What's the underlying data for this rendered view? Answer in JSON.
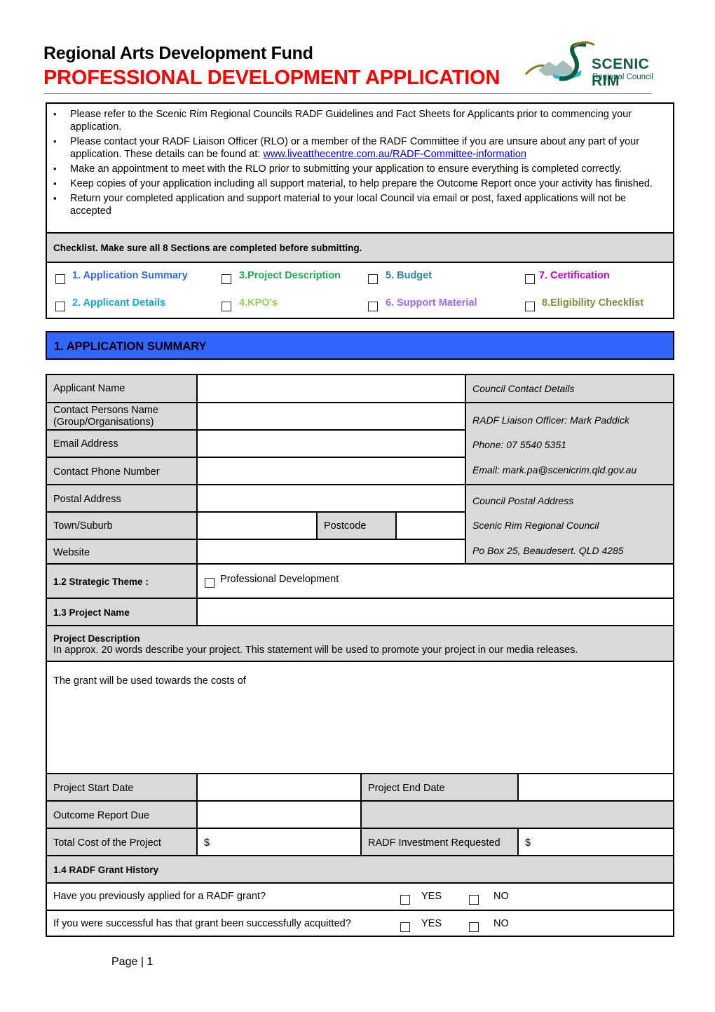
{
  "header": {
    "title": "Regional Arts Development Fund",
    "subtitle": "PROFESSIONAL DEVELOPMENT APPLICATION",
    "logo": {
      "name": "SCENIC RIM",
      "sub": "Regional Council"
    }
  },
  "intro": {
    "items": [
      {
        "bullet": "•",
        "text": "Please refer to the Scenic Rim Regional Councils RADF Guidelines and Fact Sheets for Applicants prior to commencing your application."
      },
      {
        "bullet": "•",
        "text_before": "Please contact your RADF Liaison Officer (RLO) or a member of the RADF Committee if you are unsure about any part of your application. These details can be found at: ",
        "link": "www.liveatthecentre.com.au/RADF-Committee-information"
      },
      {
        "bullet": "•",
        "text": "Make an appointment to meet with the RLO prior to submitting your application to ensure everything is completed correctly."
      },
      {
        "bullet": "▪",
        "text": " Keep copies of your application including all support material, to help prepare the Outcome Report once your activity has finished."
      },
      {
        "bullet": "▪",
        "text": " Return your completed application and support material to your local Council via email or post, faxed applications will not be accepted"
      }
    ],
    "checklist_heading": "Checklist. Make sure all 8 Sections are completed before submitting.",
    "checklist": [
      {
        "label": "1. Application Summary",
        "color": "#3366ff"
      },
      {
        "label": "3.Project Description",
        "color": "#1faa55"
      },
      {
        "label": "5. Budget",
        "color": "#31859c"
      },
      {
        "label": "7. Certification",
        "color": "#cc00cc"
      },
      {
        "label": "2. Applicant Details",
        "color": "#14a5e0"
      },
      {
        "label": "4.KPO's",
        "color": "#92d050"
      },
      {
        "label": "6. Support Material",
        "color": "#9966ff"
      },
      {
        "label": "8.Eligibility Checklist",
        "color": "#76923c"
      }
    ]
  },
  "section1": {
    "title": "1. APPLICATION SUMMARY",
    "color": "#3366ff",
    "fields": {
      "applicant_name": "Applicant Name",
      "contact_person_1": "Contact Persons Name",
      "contact_person_2": "(Group/Organisations)",
      "email": "Email Address",
      "phone": "Contact Phone Number",
      "postal": "Postal Address",
      "town": "Town/Suburb",
      "postcode": "Postcode",
      "website": "Website"
    },
    "council": {
      "contact_heading": "Council Contact Details",
      "officer": "RADF Liaison Officer:  Mark Paddick",
      "phone": "Phone:  07 5540 5351",
      "email": "Email:  mark.pa@scenicrim.qld.gov.au",
      "postal_heading": "Council Postal Address",
      "postal_line1": "Scenic Rim Regional Council",
      "postal_line2": "Po Box 25, Beaudesert. QLD 4285"
    },
    "strategic_theme": {
      "label": "1.2 Strategic Theme  :",
      "option": "Professional Development"
    },
    "project_name": {
      "label": "1.3 Project Name",
      "value": ""
    },
    "project_description": {
      "heading": "Project Description",
      "instructions": "In approx. 20 words describe your project. This statement will be used to promote your project in our media releases.",
      "value": "The grant will be used towards the costs of"
    },
    "dates": {
      "start_label": "Project Start Date",
      "end_label": "Project End Date",
      "outcome_label": "Outcome Report Due"
    },
    "costs": {
      "total_label": "Total Cost of the Project",
      "total_value": "$",
      "requested_label": "RADF Investment Requested",
      "requested_value": "$"
    },
    "grant_history": {
      "heading": "1.4 RADF Grant History",
      "questions": [
        {
          "text": "Have you previously applied for a RADF grant?",
          "yes": "YES",
          "no": "NO"
        },
        {
          "text": "If you were successful has that grant been successfully acquitted?",
          "yes": "YES",
          "no": "NO"
        }
      ]
    }
  },
  "footer": {
    "page": "Page | 1"
  }
}
